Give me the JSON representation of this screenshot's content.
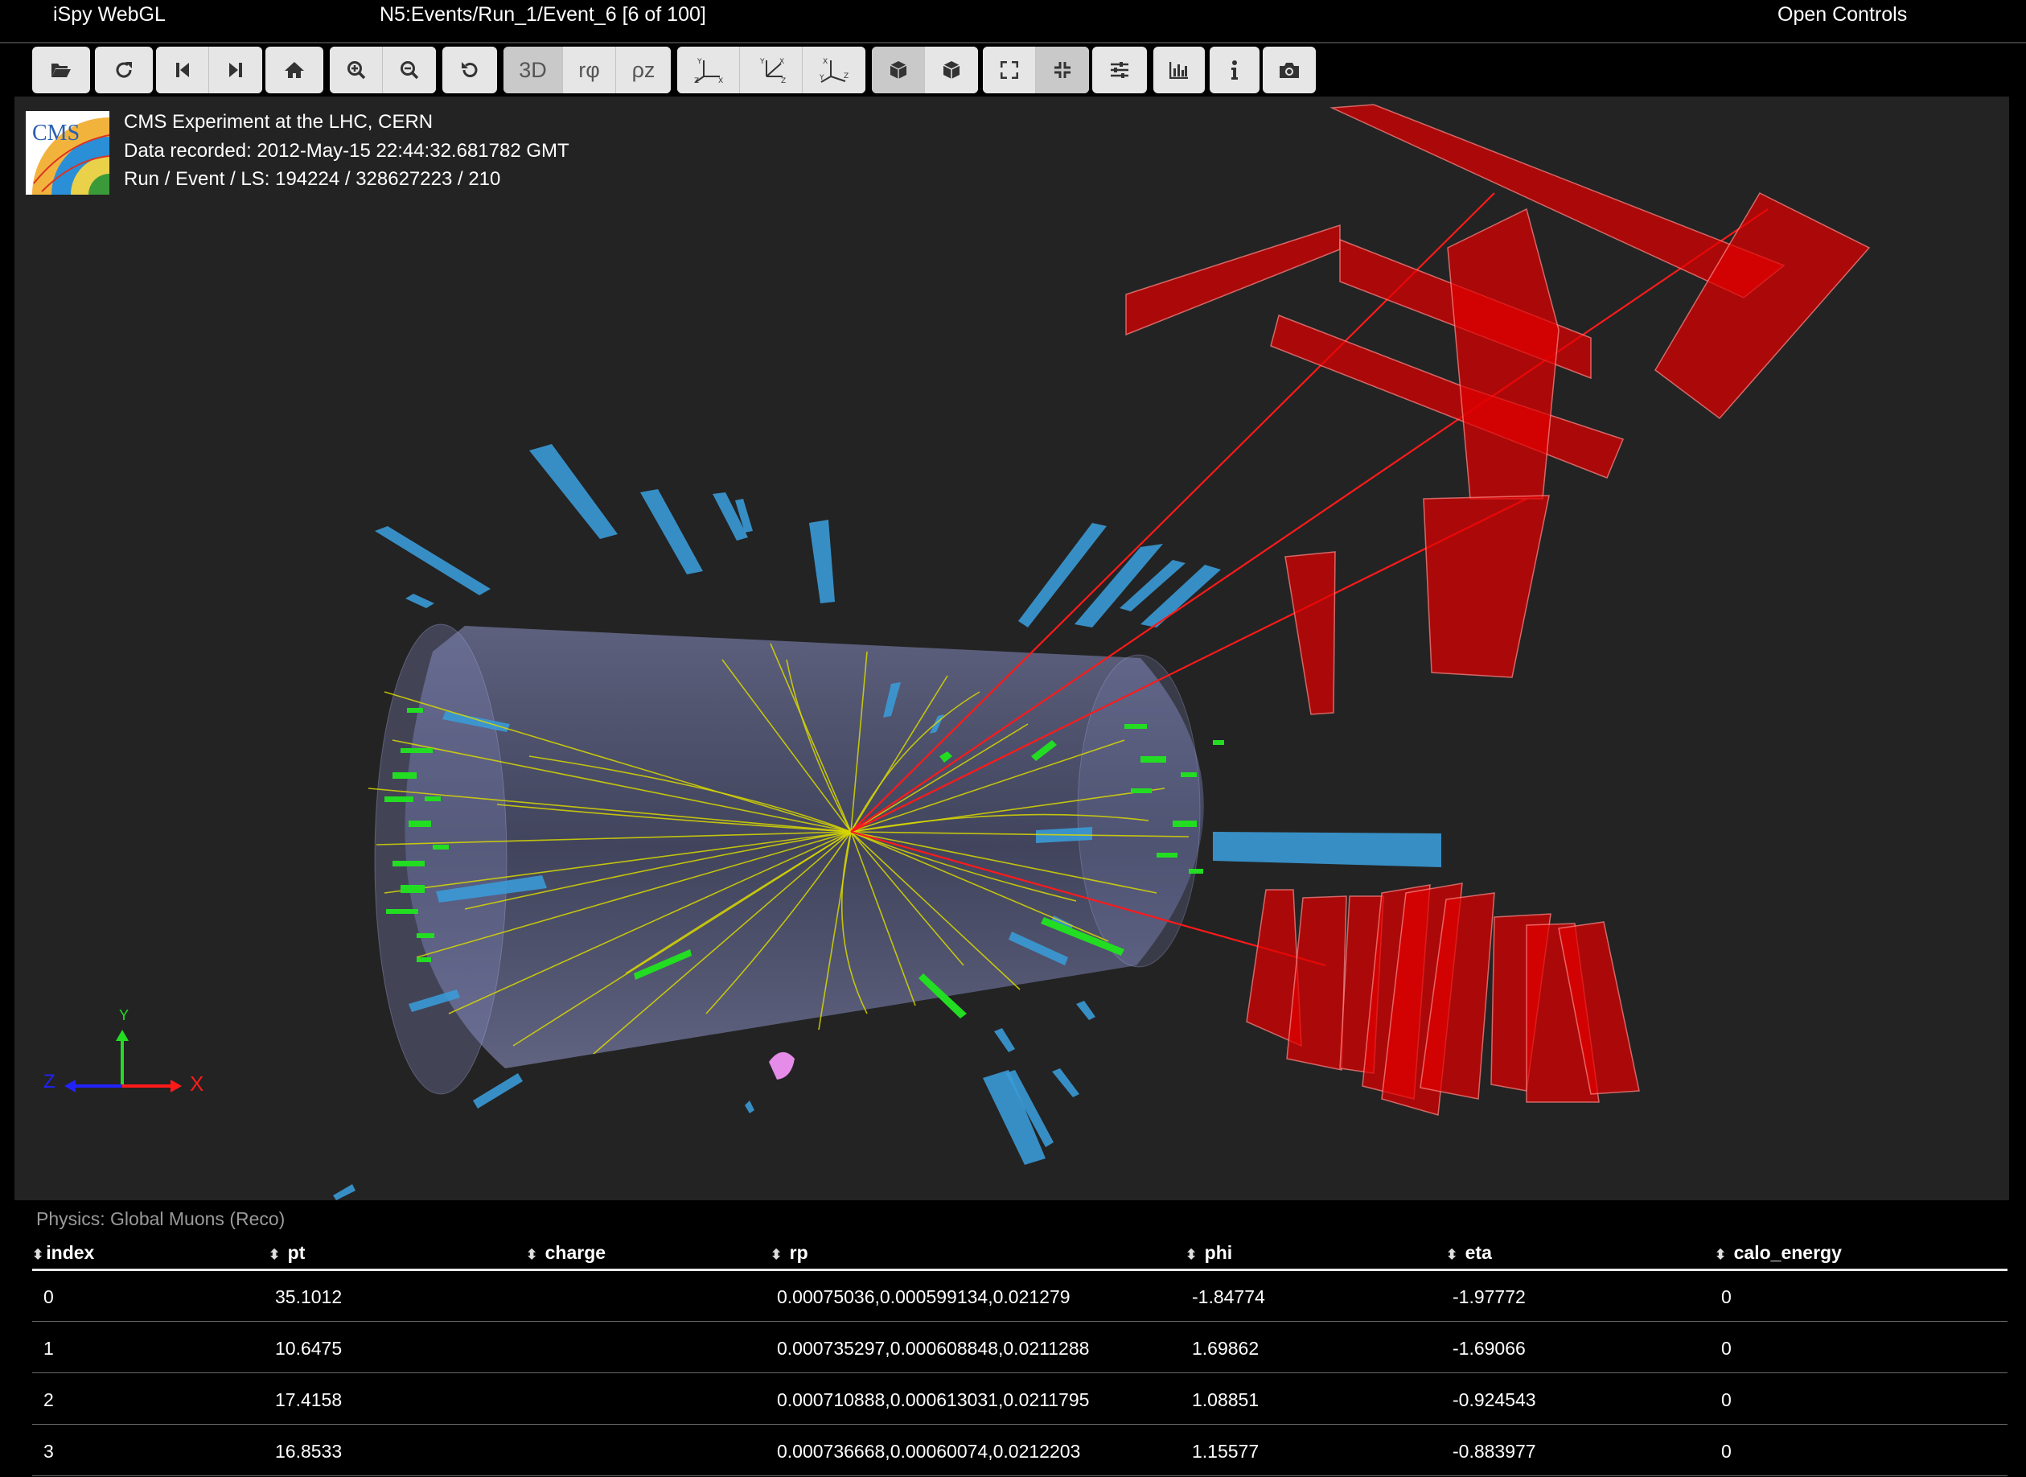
{
  "app": {
    "title": "iSpy WebGL",
    "event_path": "N5:Events/Run_1/Event_6 [6 of 100]",
    "open_controls": "Open Controls"
  },
  "toolbar": {
    "view_3d": "3D",
    "view_rphi": "rφ",
    "view_rhoz": "ρz",
    "buttons": [
      "folder-open-icon",
      "reload-icon",
      "previous-event-icon",
      "next-event-icon",
      "home-icon",
      "zoom-in-icon",
      "zoom-out-icon",
      "reset-icon",
      "axis-xyz-icon",
      "axis-yxz-icon",
      "axis-zxy-icon",
      "perspective-cube-icon",
      "orthographic-cube-icon",
      "expand-icon",
      "compress-icon",
      "settings-sliders-icon",
      "chart-icon",
      "info-icon",
      "camera-icon"
    ]
  },
  "event_info": {
    "experiment": "CMS Experiment at the LHC, CERN",
    "recorded": "Data recorded: 2012-May-15 22:44:32.681782 GMT",
    "run_event": "Run / Event / LS: 194224 / 328627223 / 210",
    "logo_text": "CMS"
  },
  "axes": {
    "x": "X",
    "y": "Y",
    "z": "Z"
  },
  "colors": {
    "background": "#232323",
    "muon": "#ff0000",
    "tracks": "#d9d900",
    "hits": "#22dd22",
    "calo": "#3399d6",
    "tracker_volume": "#8a90c8"
  },
  "table": {
    "title": "Physics: Global Muons (Reco)",
    "columns": [
      "index",
      "pt",
      "charge",
      "rp",
      "phi",
      "eta",
      "calo_energy"
    ],
    "rows": [
      [
        "0",
        "35.1012",
        "",
        "0.00075036,0.000599134,0.021279",
        "-1.84774",
        "-1.97772",
        "0"
      ],
      [
        "1",
        "10.6475",
        "",
        "0.000735297,0.000608848,0.0211288",
        "1.69862",
        "-1.69066",
        "0"
      ],
      [
        "2",
        "17.4158",
        "",
        "0.000710888,0.000613031,0.0211795",
        "1.08851",
        "-0.924543",
        "0"
      ],
      [
        "3",
        "16.8533",
        "",
        "0.000736668,0.00060074,0.0212203",
        "1.15577",
        "-0.883977",
        "0"
      ]
    ]
  }
}
